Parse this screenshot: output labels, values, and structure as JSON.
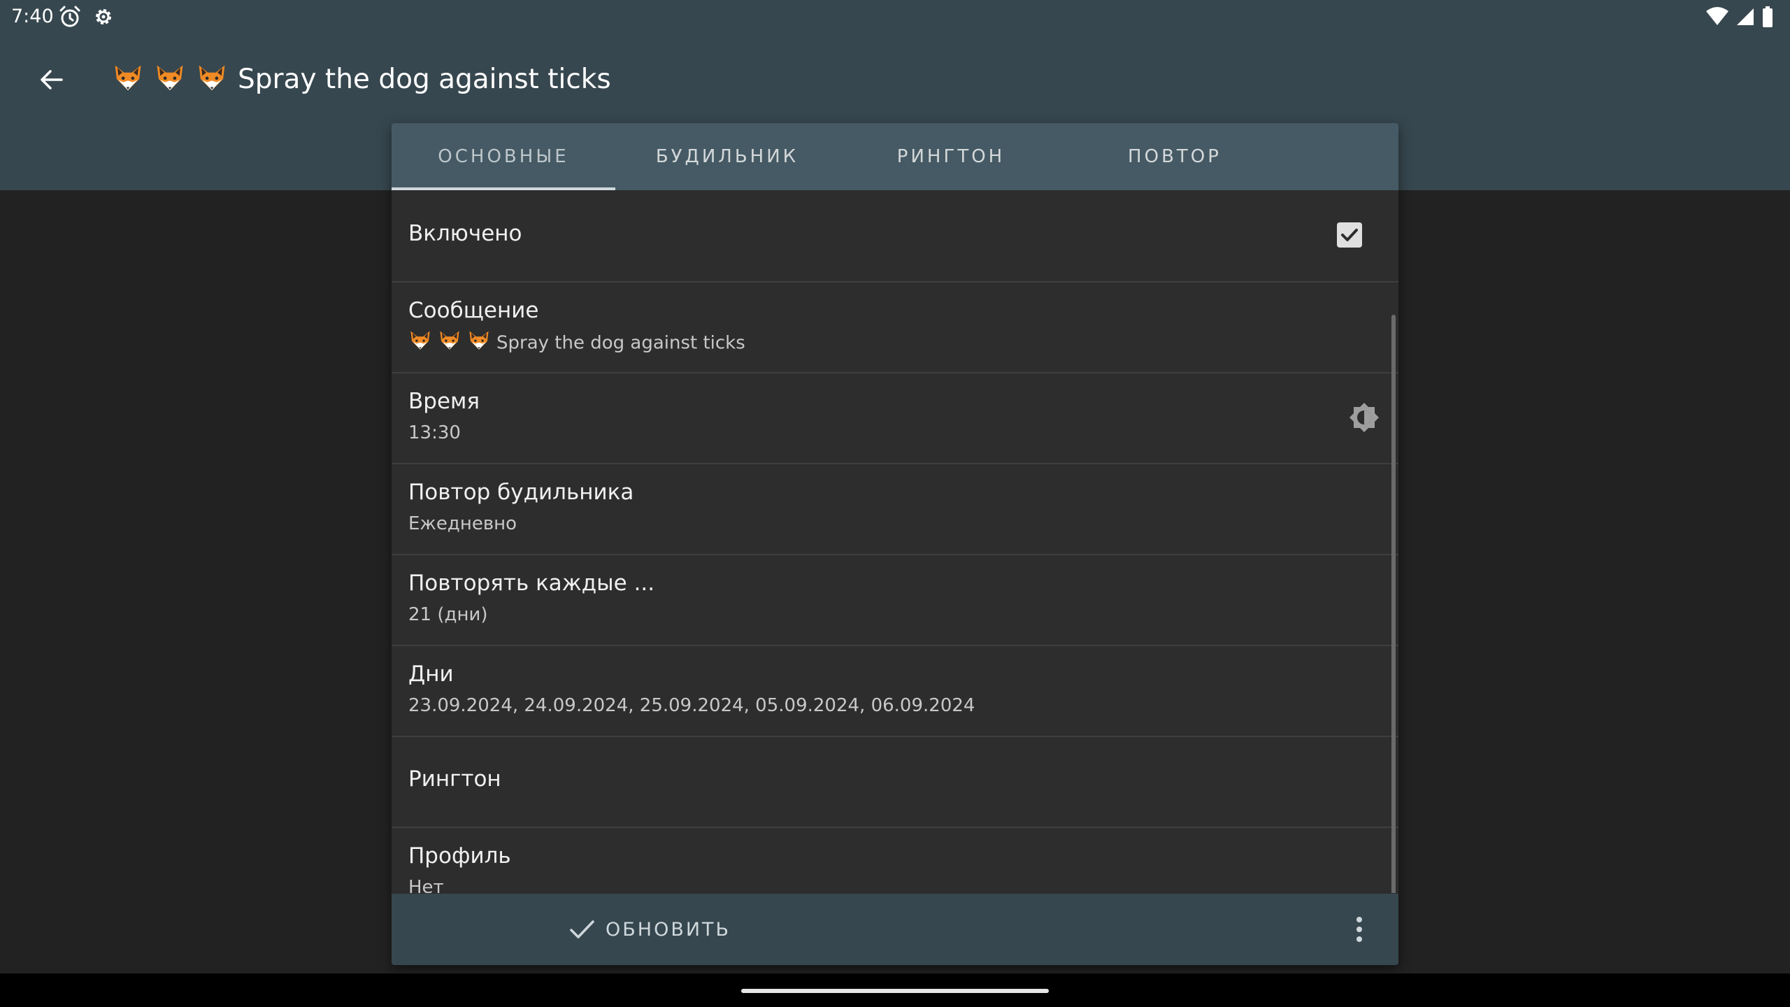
{
  "status_bar": {
    "time": "7:40",
    "left_icons": [
      "alarm-clock-icon",
      "gear-icon"
    ],
    "right_icons": [
      "wifi-icon",
      "cell-signal-icon",
      "battery-icon"
    ]
  },
  "app_bar": {
    "back_icon": "arrow-back-icon",
    "title": "Spray the dog against ticks",
    "title_emoji_count": 3,
    "title_emoji": "fox-face"
  },
  "tabs": [
    {
      "label": "ОСНОВНЫЕ",
      "active": true
    },
    {
      "label": "БУДИЛЬНИК",
      "active": false
    },
    {
      "label": "РИНГТОН",
      "active": false
    },
    {
      "label": "ПОВТОР",
      "active": false
    }
  ],
  "settings": {
    "enabled": {
      "title": "Включено",
      "checked": true
    },
    "message": {
      "title": "Сообщение",
      "value": "Spray the dog against ticks"
    },
    "time": {
      "title": "Время",
      "value": "13:30",
      "icon": "theme-brightness-icon"
    },
    "alarm_repeat": {
      "title": "Повтор будильника",
      "value": "Ежедневно"
    },
    "repeat_every": {
      "title": "Повторять каждые ...",
      "value": "21 (дни)"
    },
    "days": {
      "title": "Дни",
      "value": "23.09.2024, 24.09.2024, 25.09.2024, 05.09.2024, 06.09.2024"
    },
    "ringtone": {
      "title": "Рингтон"
    },
    "profile": {
      "title": "Профиль",
      "value": "Нет"
    }
  },
  "bottom_bar": {
    "update_label": "ОБНОВИТЬ",
    "update_icon": "check-icon",
    "more_icon": "more-vertical-icon"
  },
  "colors": {
    "app_bar": "#37474f",
    "tab_bar": "#455a64",
    "dialog_bg": "#2d2d2d",
    "page_bg": "#222222"
  }
}
